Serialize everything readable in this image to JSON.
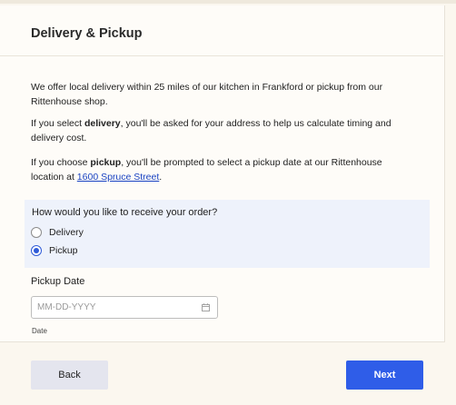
{
  "section": {
    "title": "Delivery & Pickup"
  },
  "intro": {
    "p1": "We offer local delivery within 25 miles of our kitchen in Frankford or pickup from our Rittenhouse shop.",
    "p2_before": "If you select ",
    "p2_bold": "delivery",
    "p2_after": ", you'll be asked for your address to help us calculate timing and delivery cost.",
    "p3_before": "If you choose ",
    "p3_bold": "pickup",
    "p3_middle": ", you'll be prompted to select a pickup date at our Rittenhouse location at ",
    "p3_link": "1600 Spruce Street",
    "p3_after": "."
  },
  "question": {
    "label": "How would you like to receive your order?",
    "options": [
      {
        "label": "Delivery",
        "selected": false
      },
      {
        "label": "Pickup",
        "selected": true
      }
    ]
  },
  "pickup_date": {
    "label": "Pickup Date",
    "placeholder": "MM-DD-YYYY",
    "value": "",
    "helper": "Date",
    "icon": "calendar-icon"
  },
  "footer": {
    "back_label": "Back",
    "next_label": "Next"
  },
  "colors": {
    "accent": "#2f5de8",
    "question_bg": "#eef2fb",
    "page_bg": "#fbf7ef"
  }
}
